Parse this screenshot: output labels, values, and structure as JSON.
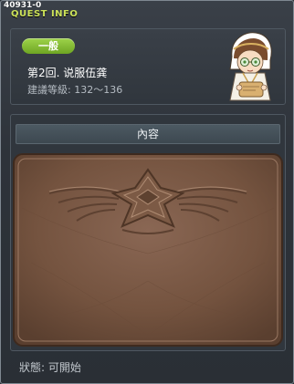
{
  "window": {
    "quest_id": "40931-0",
    "title": "QUEST INFO"
  },
  "quest": {
    "category": "一般",
    "name": "第2回. 说服伍龚",
    "level_label": "建議等級: 132～136"
  },
  "content": {
    "header": "內容"
  },
  "status": {
    "text": "狀態:  可開始"
  },
  "colors": {
    "title_accent": "#cde35a",
    "category_badge": "#86c036",
    "scroll_brown": "#7a5a48"
  },
  "icons": {
    "npc": "npc-portrait-icon",
    "emblem": "winged-emblem-icon"
  }
}
